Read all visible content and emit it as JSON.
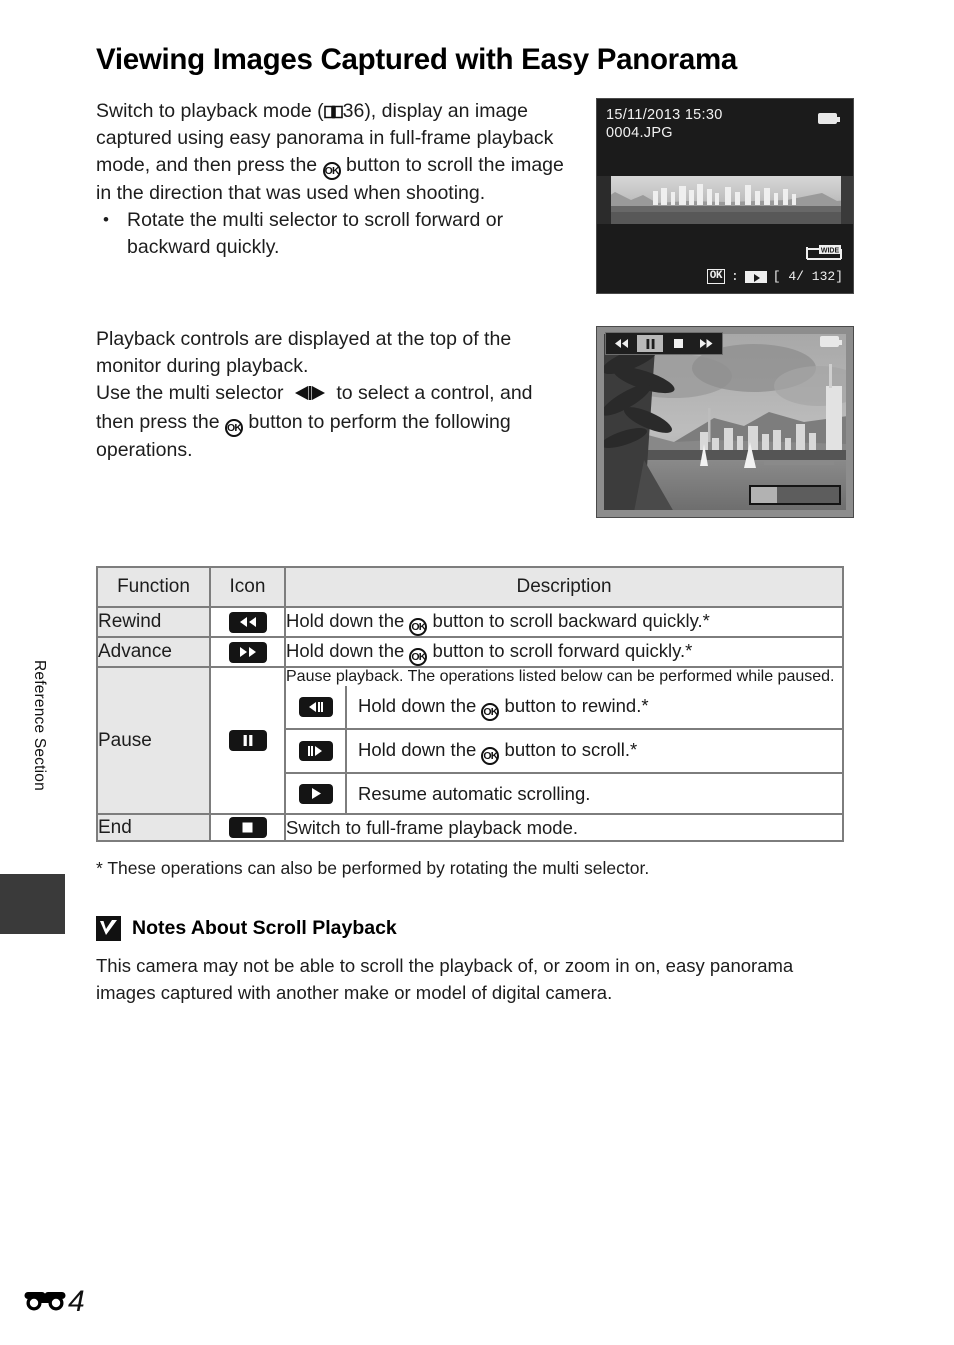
{
  "page": {
    "title": "Viewing Images Captured with Easy Panorama",
    "side_tab_label": "Reference Section",
    "page_marker_icon": "e-reference-icon",
    "page_number": "4"
  },
  "intro": {
    "para1_a": "Switch to playback mode (",
    "book_icon": "book-icon",
    "para1_ref": "36",
    "para1_b": "), display an image captured using easy panorama in full-frame playback mode, and then press the ",
    "ok_icon": "OK",
    "para1_c": " button to scroll the image in the direction that was used when shooting.",
    "bullets": [
      "Rotate the multi selector to scroll forward or backward quickly."
    ]
  },
  "second": {
    "para_a": "Playback controls are displayed at the top of the monitor during playback.",
    "para_b_1": "Use the multi selector ",
    "multi_selector_icon": "left-right-arrows-icon",
    "para_b_2": " to select a control, and then press the ",
    "ok_icon": "OK",
    "para_b_3": " button to perform the following operations."
  },
  "shot1": {
    "name": "camera-screen-full-frame-playback",
    "datetime": "15/11/2013  15:30",
    "filename": "0004.JPG",
    "battery_icon": "battery-icon",
    "ok_label": "OK",
    "separator": ":",
    "play_icon": "play-film-icon",
    "counter": "[    4/ 132]",
    "wide_label": "WIDE",
    "wide_icon": "panorama-wide-icon"
  },
  "shot2": {
    "name": "camera-screen-scroll-playback",
    "battery_icon": "battery-icon",
    "controls": [
      {
        "icon": "rewind-icon",
        "glyph": "◀◀",
        "selected": false,
        "name": "control-rewind"
      },
      {
        "icon": "pause-icon",
        "glyph": "‖",
        "selected": true,
        "name": "control-pause"
      },
      {
        "icon": "stop-icon",
        "glyph": "■",
        "selected": false,
        "name": "control-end"
      },
      {
        "icon": "fast-forward-icon",
        "glyph": "▶▶",
        "selected": false,
        "name": "control-advance"
      }
    ],
    "progress_percent": 29
  },
  "table": {
    "headers": [
      "Function",
      "Icon",
      "Description"
    ],
    "rows": [
      {
        "function": "Rewind",
        "icon": "rewind-icon",
        "desc_a": "Hold down the ",
        "desc_ok": "OK",
        "desc_b": " button to scroll backward quickly.*"
      },
      {
        "function": "Advance",
        "icon": "fast-forward-icon",
        "desc_a": "Hold down the ",
        "desc_ok": "OK",
        "desc_b": " button to scroll forward quickly.*"
      },
      {
        "function": "Pause",
        "icon": "pause-icon",
        "desc_main": "Pause playback. The operations listed below can be performed while paused.",
        "sub_rows": [
          {
            "icon": "step-rewind-icon",
            "desc_a": "Hold down the ",
            "desc_ok": "OK",
            "desc_b": " button to rewind.*"
          },
          {
            "icon": "step-forward-icon",
            "desc_a": "Hold down the ",
            "desc_ok": "OK",
            "desc_b": " button to scroll.*"
          },
          {
            "icon": "play-icon",
            "desc_a": "Resume automatic scrolling.",
            "desc_ok": "",
            "desc_b": ""
          }
        ]
      },
      {
        "function": "End",
        "icon": "stop-icon",
        "desc_a": "Switch to full-frame playback mode.",
        "desc_ok": "",
        "desc_b": ""
      }
    ]
  },
  "footnote": "*   These operations can also be performed by rotating the multi selector.",
  "notes": {
    "icon": "caution-check-icon",
    "heading": "Notes About Scroll Playback",
    "body": "This camera may not be able to scroll the playback of, or zoom in on, easy panorama images captured with another make or model of digital camera."
  },
  "colors": {
    "table_header_bg": "#e7e7e7",
    "table_border": "#7d7d7d",
    "chip_bg": "#141414",
    "side_tab_block": "#3a3a3a"
  }
}
